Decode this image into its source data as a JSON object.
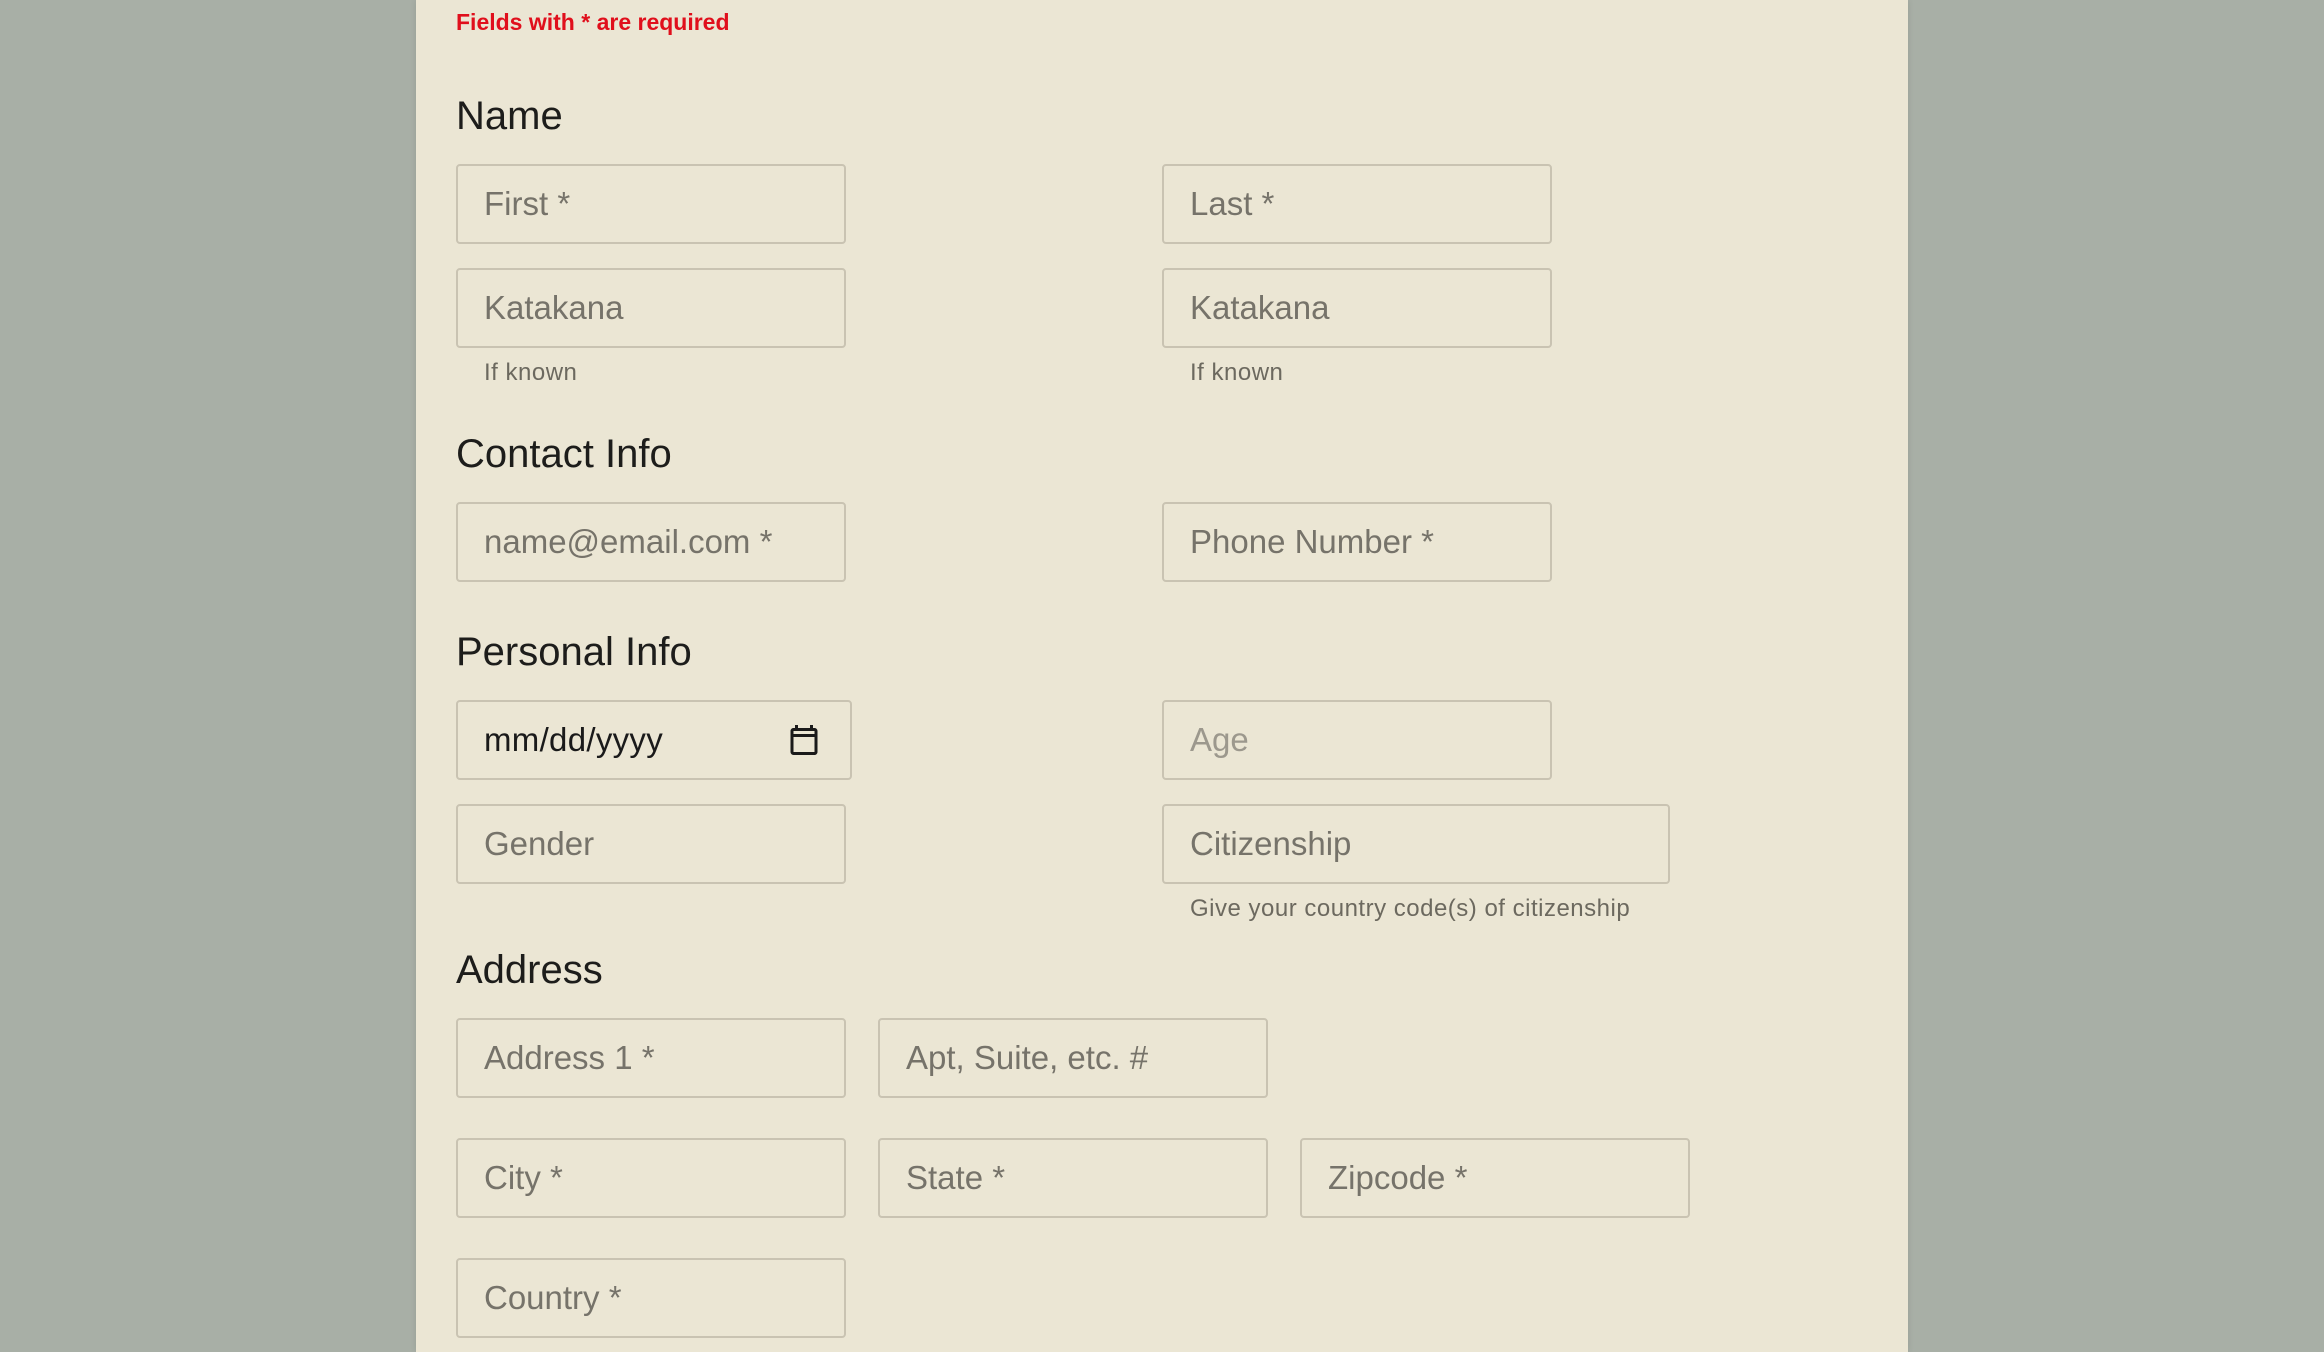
{
  "form": {
    "required_note": "Fields with * are required",
    "sections": {
      "name": {
        "title": "Name",
        "first_placeholder": "First *",
        "last_placeholder": "Last *",
        "first_katakana_placeholder": "Katakana",
        "last_katakana_placeholder": "Katakana",
        "first_katakana_helper": "If known",
        "last_katakana_helper": "If known"
      },
      "contact": {
        "title": "Contact Info",
        "email_placeholder": "name@email.com *",
        "phone_placeholder": "Phone Number *"
      },
      "personal": {
        "title": "Personal Info",
        "dob_value": "mm/dd/yyyy",
        "age_placeholder": "Age",
        "gender_placeholder": "Gender",
        "citizenship_placeholder": "Citizenship",
        "citizenship_helper": "Give your country code(s) of citizenship"
      },
      "address": {
        "title": "Address",
        "address1_placeholder": "Address 1 *",
        "apt_placeholder": "Apt, Suite, etc. #",
        "city_placeholder": "City *",
        "state_placeholder": "State *",
        "zip_placeholder": "Zipcode *",
        "country_placeholder": "Country *"
      }
    }
  },
  "icons": {
    "date_picker": "calendar-icon"
  },
  "colors": {
    "page_background": "#a8afa6",
    "panel_background": "#ebe6d4",
    "required_note": "#e00f1c",
    "field_border": "#c9c3b2",
    "heading_text": "#1d1d1b"
  }
}
